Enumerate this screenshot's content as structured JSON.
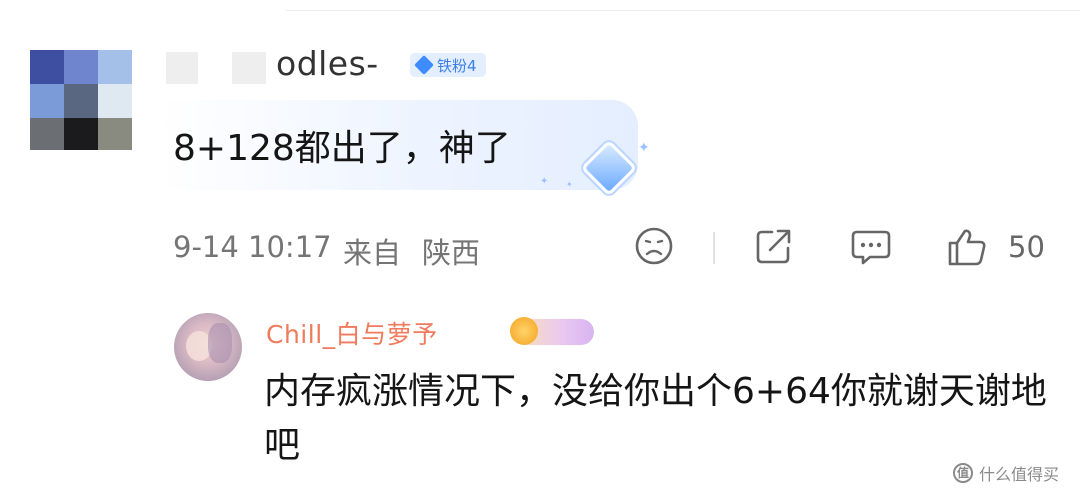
{
  "comment": {
    "username_visible": "odles-",
    "fan_badge": "铁粉4",
    "text": "8+128都出了，神了",
    "timestamp": "9-14 10:17",
    "source_prefix": "来自",
    "location": "陕西",
    "like_count": "50"
  },
  "reply": {
    "username": "Chill_白与萝予",
    "text": "内存疯涨情况下，没给你出个6+64你就谢天谢地吧"
  },
  "watermark": {
    "text": "什么值得买"
  },
  "icons": {
    "dislike": "sad-face-icon",
    "share": "share-icon",
    "comment": "comment-icon",
    "like": "thumbs-up-icon",
    "badge": "diamond-icon"
  },
  "colors": {
    "badge_blue": "#3f8cff",
    "reply_name": "#ef7a5c",
    "meta_gray": "#757575"
  }
}
